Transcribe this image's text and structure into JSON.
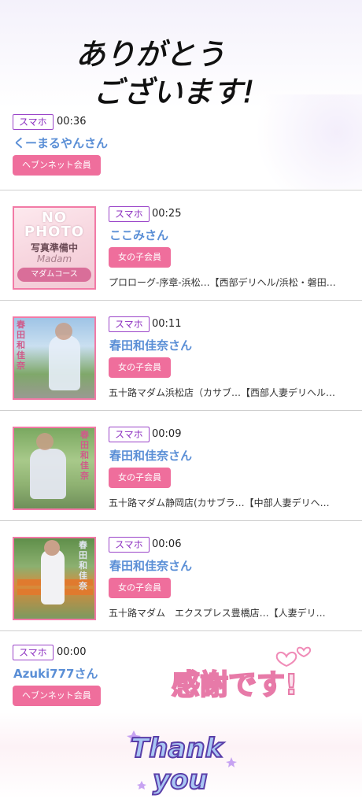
{
  "header": {
    "line1": "ありがとう",
    "line2": "ございます!"
  },
  "entries": [
    {
      "device": "スマホ",
      "time": "00:36",
      "name": "くーまるやんさん",
      "badge": "ヘブンネット会員",
      "shop": ""
    },
    {
      "device": "スマホ",
      "time": "00:25",
      "name": "ここみさん",
      "badge": "女の子会員",
      "shop": "プロローグ-序章-浜松…【西部デリヘル/浜松・磐田…",
      "thumb": {
        "top": "NO",
        "mid": "PHOTO",
        "sub": "写真準備中",
        "script": "Madam",
        "ribbon": "マダムコース"
      }
    },
    {
      "device": "スマホ",
      "time": "00:11",
      "name": "春田和佳奈さん",
      "badge": "女の子会員",
      "shop": "五十路マダム浜松店（カサブ…【西部人妻デリヘル…",
      "thumb": {
        "vertical": "春田和佳奈"
      }
    },
    {
      "device": "スマホ",
      "time": "00:09",
      "name": "春田和佳奈さん",
      "badge": "女の子会員",
      "shop": "五十路マダム静岡店(カサブラ…【中部人妻デリヘ…",
      "thumb": {
        "vertical": "春田和佳奈"
      }
    },
    {
      "device": "スマホ",
      "time": "00:06",
      "name": "春田和佳奈さん",
      "badge": "女の子会員",
      "shop": "五十路マダム　エクスプレス豊橋店…【人妻デリ…",
      "thumb": {
        "vertical": "春田和佳奈"
      }
    },
    {
      "device": "スマホ",
      "time": "00:00",
      "name": "Azuki777さん",
      "badge": "ヘブンネット会員",
      "shop": ""
    }
  ],
  "footer": {
    "thanks": "感謝です!",
    "thankyou_line1": "Thank",
    "thankyou_line2": "you"
  },
  "colors": {
    "tag_border": "#9b46c9",
    "name": "#5b8fd6",
    "badge": "#ef6e9c",
    "thumb_border": "#f27aa6"
  }
}
